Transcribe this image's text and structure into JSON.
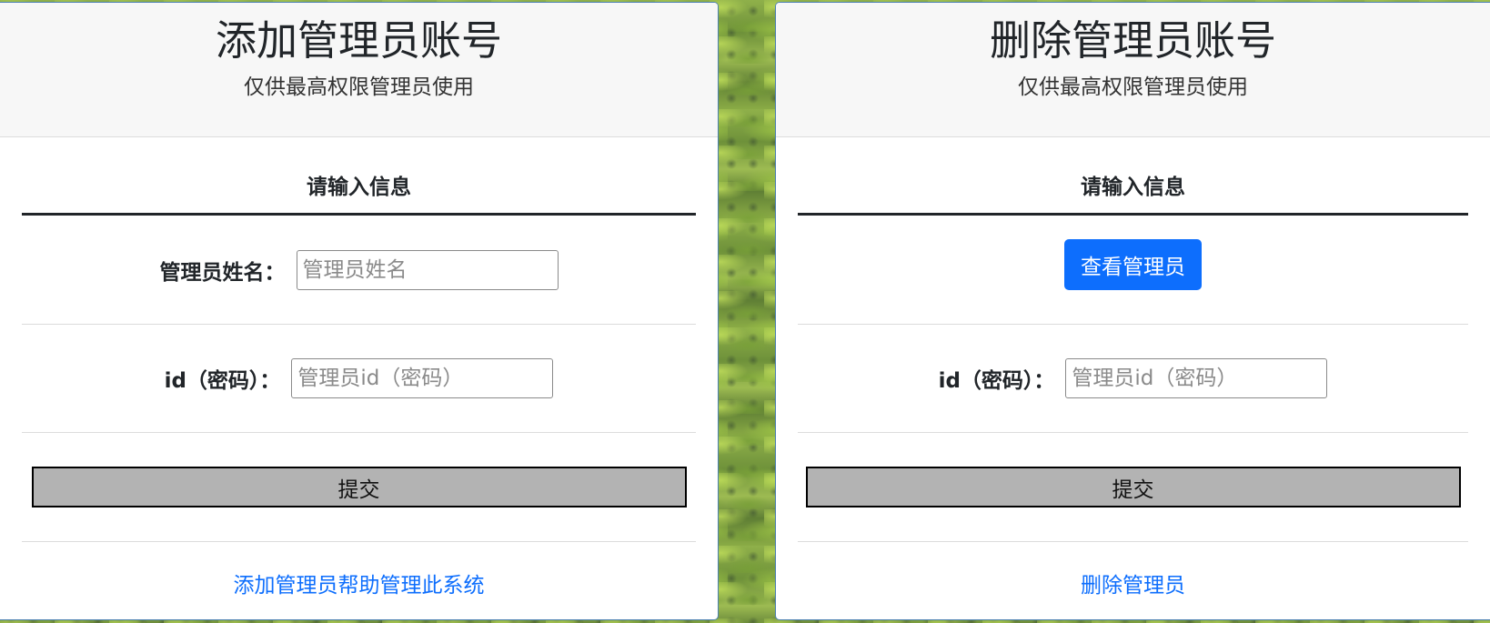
{
  "add_panel": {
    "title": "添加管理员账号",
    "subtitle": "仅供最高权限管理员使用",
    "section_heading": "请输入信息",
    "name_label": "管理员姓名：",
    "name_placeholder": "管理员姓名",
    "id_label": "id（密码）：",
    "id_placeholder": "管理员id（密码）",
    "submit_label": "提交",
    "footer_link": "添加管理员帮助管理此系统"
  },
  "delete_panel": {
    "title": "删除管理员账号",
    "subtitle": "仅供最高权限管理员使用",
    "section_heading": "请输入信息",
    "view_button": "查看管理员",
    "id_label": "id（密码）：",
    "id_placeholder": "管理员id（密码）",
    "submit_label": "提交",
    "footer_link": "删除管理员"
  },
  "colors": {
    "primary": "#0d6efd",
    "submit_bg": "#b3b3b3",
    "header_bg": "#f7f7f7"
  }
}
